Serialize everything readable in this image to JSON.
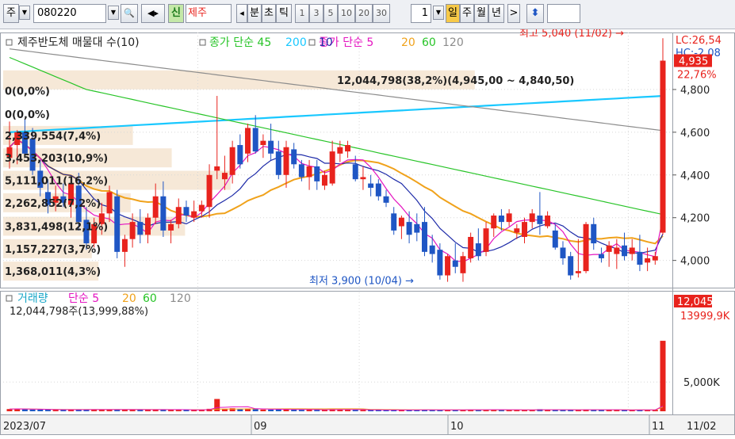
{
  "toolbar": {
    "market_label": "주",
    "code_value": "080220",
    "search_icon": "magnifier-icon",
    "speaker_icon": "speaker-icon",
    "new_badge": "신",
    "stock_name": "제주",
    "prev_arrow": "◂",
    "period_labels": [
      "분",
      "초",
      "틱"
    ],
    "interval_buttons": [
      "1",
      "3",
      "5",
      "10",
      "20",
      "30"
    ],
    "count_value": "1",
    "range_buttons": [
      "일",
      "주",
      "월",
      "년"
    ],
    "next_arrow": ">",
    "updown_icon": "updown-arrow-icon",
    "extra_value": ""
  },
  "colors": {
    "up": "#e8231d",
    "down": "#1f56c4",
    "ma5": "#e414c0",
    "ma10": "#1d2aa8",
    "ma20": "#f0a21b",
    "ma60": "#27c427",
    "ma120": "#8c8c8c",
    "ma45": "#19c8ff",
    "vp_band": "#f5e6d3",
    "grid": "#d7d7d7"
  },
  "chart_data": {
    "type": "candlestick",
    "title": "제주반도체",
    "price_legend": {
      "title": "제주반도체 매물대 수(10)",
      "items": [
        {
          "text": "종가 단순 45",
          "color": "#27c427"
        },
        {
          "text": "200",
          "color": "#19c8ff"
        },
        {
          "text": "종가 단순 5",
          "color": "#e414c0"
        },
        {
          "text": "10",
          "color": "#1d2aa8"
        },
        {
          "text": "20",
          "color": "#f0a21b"
        },
        {
          "text": "60",
          "color": "#27c427"
        },
        {
          "text": "120",
          "color": "#8c8c8c"
        }
      ]
    },
    "volume_legend": {
      "title": "거래량",
      "items": [
        {
          "text": "단순 5",
          "color": "#e414c0"
        },
        {
          "text": "20",
          "color": "#f0a21b"
        },
        {
          "text": "60",
          "color": "#27c427"
        },
        {
          "text": "120",
          "color": "#8c8c8c"
        }
      ]
    },
    "volume_info": "12,044,798주(13,999,88%)",
    "x_ticks": [
      "2023/07",
      "09",
      "10",
      "11",
      "11/02"
    ],
    "y_ticks": [
      "4,800",
      "4,600",
      "4,400",
      "4,200",
      "4,000"
    ],
    "volume_y_ticks": [
      "5,000K"
    ],
    "ylim": [
      3880,
      5000
    ],
    "high_annotation": "최고 5,040 (11/02) →",
    "low_annotation": "최저 3,900 (10/04) →",
    "current_price_label": "4,935",
    "current_volume_label": "12,045",
    "lc_label": "LC:26,54",
    "hc_label": "HC:-2,08",
    "pct_label": "22,76%",
    "volume_pct_label": "13999,9K",
    "volume_profile": [
      {
        "price": 4845,
        "label": "12,044,798(38,2%)(4,945,00 ~ 4,840,50)",
        "pct": 38.2
      },
      {
        "price": 4795,
        "label": "0(0,0%)",
        "pct": 0.0
      },
      {
        "price": 4685,
        "label": "0(0,0%)",
        "pct": 0.0
      },
      {
        "price": 4585,
        "label": "2,339,554(7,4%)",
        "pct": 7.4
      },
      {
        "price": 4480,
        "label": "3,453,203(10,9%)",
        "pct": 10.9
      },
      {
        "price": 4375,
        "label": "5,111,011(16,2%)",
        "pct": 16.2
      },
      {
        "price": 4270,
        "label": "2,262,852(7,2%)",
        "pct": 7.2
      },
      {
        "price": 4160,
        "label": "3,831,498(12,1%)",
        "pct": 12.1
      },
      {
        "price": 4055,
        "label": "1,157,227(3,7%)",
        "pct": 3.7
      },
      {
        "price": 3950,
        "label": "1,368,011(4,3%)",
        "pct": 4.3
      }
    ],
    "candles": [
      {
        "o": 4480,
        "h": 4650,
        "l": 4430,
        "c": 4530
      },
      {
        "o": 4540,
        "h": 4610,
        "l": 4450,
        "c": 4600
      },
      {
        "o": 4600,
        "h": 4660,
        "l": 4480,
        "c": 4500
      },
      {
        "o": 4570,
        "h": 4620,
        "l": 4400,
        "c": 4420
      },
      {
        "o": 4420,
        "h": 4470,
        "l": 4300,
        "c": 4340
      },
      {
        "o": 4320,
        "h": 4380,
        "l": 4220,
        "c": 4260
      },
      {
        "o": 4270,
        "h": 4350,
        "l": 4230,
        "c": 4300
      },
      {
        "o": 4300,
        "h": 4360,
        "l": 4250,
        "c": 4270
      },
      {
        "o": 4260,
        "h": 4380,
        "l": 4200,
        "c": 4360
      },
      {
        "o": 4350,
        "h": 4410,
        "l": 4140,
        "c": 4180
      },
      {
        "o": 4190,
        "h": 4250,
        "l": 4050,
        "c": 4080
      },
      {
        "o": 4080,
        "h": 4200,
        "l": 4060,
        "c": 4170
      },
      {
        "o": 4170,
        "h": 4270,
        "l": 4120,
        "c": 4220
      },
      {
        "o": 4220,
        "h": 4350,
        "l": 4180,
        "c": 4320
      },
      {
        "o": 4300,
        "h": 4330,
        "l": 4010,
        "c": 4040
      },
      {
        "o": 4040,
        "h": 4120,
        "l": 3970,
        "c": 4100
      },
      {
        "o": 4100,
        "h": 4220,
        "l": 4060,
        "c": 4180
      },
      {
        "o": 4180,
        "h": 4240,
        "l": 4080,
        "c": 4120
      },
      {
        "o": 4120,
        "h": 4220,
        "l": 4080,
        "c": 4200
      },
      {
        "o": 4200,
        "h": 4360,
        "l": 4170,
        "c": 4300
      },
      {
        "o": 4300,
        "h": 4370,
        "l": 4110,
        "c": 4140
      },
      {
        "o": 4140,
        "h": 4190,
        "l": 4080,
        "c": 4170
      },
      {
        "o": 4170,
        "h": 4290,
        "l": 4150,
        "c": 4250
      },
      {
        "o": 4250,
        "h": 4280,
        "l": 4180,
        "c": 4210
      },
      {
        "o": 4200,
        "h": 4280,
        "l": 4180,
        "c": 4230
      },
      {
        "o": 4230,
        "h": 4280,
        "l": 4200,
        "c": 4260
      },
      {
        "o": 4250,
        "h": 4450,
        "l": 4200,
        "c": 4400
      },
      {
        "o": 4420,
        "h": 4770,
        "l": 4380,
        "c": 4440
      },
      {
        "o": 4380,
        "h": 4490,
        "l": 4330,
        "c": 4410
      },
      {
        "o": 4400,
        "h": 4560,
        "l": 4360,
        "c": 4530
      },
      {
        "o": 4540,
        "h": 4590,
        "l": 4430,
        "c": 4450
      },
      {
        "o": 4500,
        "h": 4640,
        "l": 4460,
        "c": 4620
      },
      {
        "o": 4620,
        "h": 4680,
        "l": 4500,
        "c": 4510
      },
      {
        "o": 4540,
        "h": 4590,
        "l": 4480,
        "c": 4560
      },
      {
        "o": 4560,
        "h": 4640,
        "l": 4470,
        "c": 4500
      },
      {
        "o": 4510,
        "h": 4560,
        "l": 4380,
        "c": 4400
      },
      {
        "o": 4400,
        "h": 4560,
        "l": 4340,
        "c": 4530
      },
      {
        "o": 4520,
        "h": 4550,
        "l": 4430,
        "c": 4450
      },
      {
        "o": 4450,
        "h": 4470,
        "l": 4370,
        "c": 4390
      },
      {
        "o": 4390,
        "h": 4470,
        "l": 4330,
        "c": 4440
      },
      {
        "o": 4440,
        "h": 4470,
        "l": 4330,
        "c": 4370
      },
      {
        "o": 4350,
        "h": 4420,
        "l": 4330,
        "c": 4400
      },
      {
        "o": 4360,
        "h": 4560,
        "l": 4350,
        "c": 4510
      },
      {
        "o": 4500,
        "h": 4560,
        "l": 4460,
        "c": 4530
      },
      {
        "o": 4510,
        "h": 4560,
        "l": 4480,
        "c": 4540
      },
      {
        "o": 4450,
        "h": 4490,
        "l": 4370,
        "c": 4380
      },
      {
        "o": 4380,
        "h": 4440,
        "l": 4330,
        "c": 4390
      },
      {
        "o": 4360,
        "h": 4400,
        "l": 4300,
        "c": 4340
      },
      {
        "o": 4360,
        "h": 4380,
        "l": 4280,
        "c": 4300
      },
      {
        "o": 4300,
        "h": 4330,
        "l": 4250,
        "c": 4270
      },
      {
        "o": 4220,
        "h": 4250,
        "l": 4120,
        "c": 4140
      },
      {
        "o": 4160,
        "h": 4210,
        "l": 4100,
        "c": 4200
      },
      {
        "o": 4180,
        "h": 4230,
        "l": 4080,
        "c": 4120
      },
      {
        "o": 4170,
        "h": 4220,
        "l": 4090,
        "c": 4130
      },
      {
        "o": 4180,
        "h": 4250,
        "l": 4020,
        "c": 4040
      },
      {
        "o": 4070,
        "h": 4120,
        "l": 3990,
        "c": 4030
      },
      {
        "o": 4050,
        "h": 4080,
        "l": 3910,
        "c": 3930
      },
      {
        "o": 3930,
        "h": 4030,
        "l": 3900,
        "c": 4020
      },
      {
        "o": 4000,
        "h": 4080,
        "l": 3940,
        "c": 3970
      },
      {
        "o": 3940,
        "h": 4040,
        "l": 3900,
        "c": 4020
      },
      {
        "o": 4010,
        "h": 4130,
        "l": 3990,
        "c": 4110
      },
      {
        "o": 4080,
        "h": 4150,
        "l": 4000,
        "c": 4020
      },
      {
        "o": 4040,
        "h": 4180,
        "l": 4020,
        "c": 4150
      },
      {
        "o": 4150,
        "h": 4220,
        "l": 4110,
        "c": 4210
      },
      {
        "o": 4210,
        "h": 4240,
        "l": 4140,
        "c": 4180
      },
      {
        "o": 4180,
        "h": 4240,
        "l": 4160,
        "c": 4220
      },
      {
        "o": 4130,
        "h": 4170,
        "l": 4100,
        "c": 4150
      },
      {
        "o": 4110,
        "h": 4200,
        "l": 4080,
        "c": 4180
      },
      {
        "o": 4180,
        "h": 4240,
        "l": 4150,
        "c": 4220
      },
      {
        "o": 4210,
        "h": 4320,
        "l": 4120,
        "c": 4170
      },
      {
        "o": 4160,
        "h": 4230,
        "l": 4150,
        "c": 4210
      },
      {
        "o": 4140,
        "h": 4170,
        "l": 4050,
        "c": 4060
      },
      {
        "o": 4060,
        "h": 4090,
        "l": 3980,
        "c": 4010
      },
      {
        "o": 4020,
        "h": 4040,
        "l": 3910,
        "c": 3930
      },
      {
        "o": 3940,
        "h": 4100,
        "l": 3920,
        "c": 3950
      },
      {
        "o": 3950,
        "h": 4180,
        "l": 3940,
        "c": 4170
      },
      {
        "o": 4170,
        "h": 4200,
        "l": 4050,
        "c": 4080
      },
      {
        "o": 4030,
        "h": 4060,
        "l": 3990,
        "c": 4010
      },
      {
        "o": 4040,
        "h": 4090,
        "l": 3970,
        "c": 4070
      },
      {
        "o": 4030,
        "h": 4100,
        "l": 3960,
        "c": 4060
      },
      {
        "o": 4070,
        "h": 4130,
        "l": 4000,
        "c": 4020
      },
      {
        "o": 4030,
        "h": 4100,
        "l": 4000,
        "c": 4060
      },
      {
        "o": 4040,
        "h": 4120,
        "l": 3950,
        "c": 3980
      },
      {
        "o": 3990,
        "h": 4060,
        "l": 3950,
        "c": 4010
      },
      {
        "o": 4000,
        "h": 4040,
        "l": 3980,
        "c": 4020
      },
      {
        "o": 4130,
        "h": 5040,
        "l": 4120,
        "c": 4935
      }
    ],
    "volumes": [
      380,
      420,
      360,
      300,
      280,
      260,
      240,
      250,
      320,
      300,
      270,
      250,
      260,
      330,
      310,
      270,
      260,
      240,
      250,
      340,
      300,
      240,
      260,
      220,
      230,
      240,
      420,
      2100,
      420,
      520,
      360,
      480,
      370,
      300,
      280,
      320,
      380,
      290,
      250,
      280,
      240,
      230,
      380,
      290,
      260,
      250,
      230,
      220,
      210,
      200,
      240,
      210,
      220,
      210,
      280,
      230,
      260,
      240,
      220,
      260,
      290,
      250,
      280,
      270,
      240,
      250,
      220,
      230,
      250,
      360,
      250,
      230,
      210,
      260,
      240,
      320,
      280,
      210,
      220,
      230,
      220,
      210,
      240,
      230,
      250,
      12045
    ],
    "ma200": [
      4600,
      4602,
      4604,
      4606,
      4608,
      4610,
      4612,
      4614,
      4616,
      4618,
      4620,
      4622,
      4624,
      4626,
      4628,
      4630,
      4632,
      4634,
      4636,
      4638,
      4640,
      4642,
      4644,
      4646,
      4648,
      4650,
      4652,
      4654,
      4656,
      4658,
      4660,
      4662,
      4664,
      4666,
      4668,
      4670,
      4672,
      4674,
      4676,
      4678,
      4680,
      4682,
      4684,
      4686,
      4688,
      4690,
      4692,
      4694,
      4696,
      4698,
      4700,
      4702,
      4704,
      4706,
      4708,
      4710,
      4712,
      4714,
      4716,
      4718,
      4720,
      4722,
      4724,
      4726,
      4728,
      4730,
      4732,
      4734,
      4736,
      4738,
      4740,
      4742,
      4744,
      4746,
      4748,
      4750,
      4752,
      4754,
      4756,
      4758,
      4760,
      4762,
      4764,
      4766,
      4768,
      4770
    ]
  }
}
